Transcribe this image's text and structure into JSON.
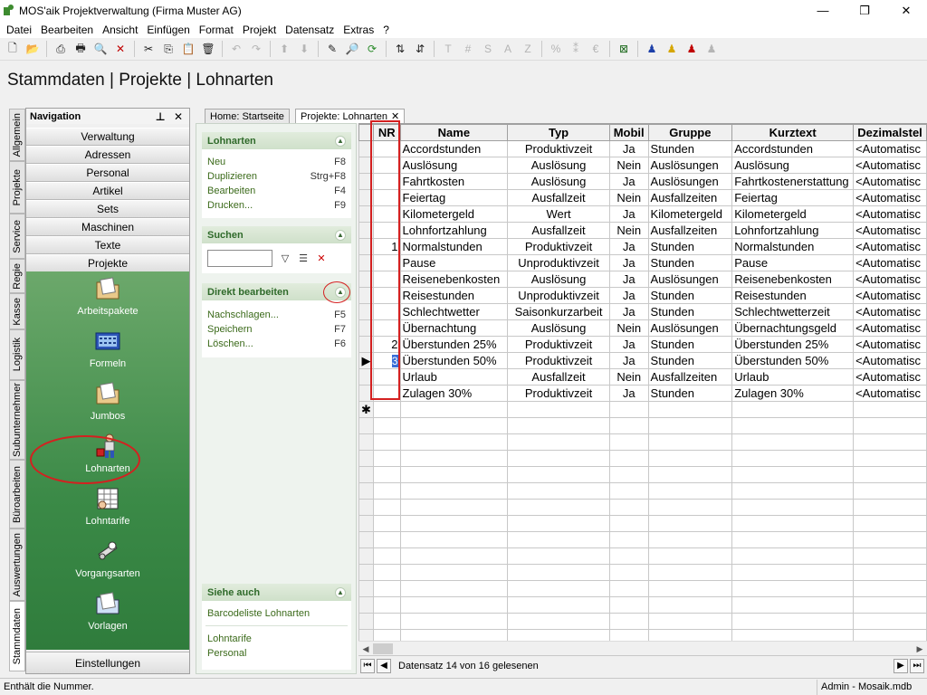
{
  "window": {
    "title": "MOS'aik Projektverwaltung (Firma Muster AG)",
    "minimize": "—",
    "maximize": "❐",
    "close": "✕"
  },
  "menu": [
    "Datei",
    "Bearbeiten",
    "Ansicht",
    "Einfügen",
    "Format",
    "Projekt",
    "Datensatz",
    "Extras",
    "?"
  ],
  "toolbar": {
    "items": [
      {
        "glyph": "🗋",
        "icon": "new-icon",
        "dis": false
      },
      {
        "glyph": "📂",
        "icon": "open-icon",
        "dis": false
      },
      {
        "sep": true
      },
      {
        "glyph": "⎙",
        "icon": "print-icon",
        "dis": false
      },
      {
        "glyph": "🖶",
        "icon": "print-preview-icon",
        "dis": false
      },
      {
        "glyph": "🔍",
        "icon": "find-icon",
        "dis": false
      },
      {
        "glyph": "✕",
        "icon": "delete-icon",
        "dis": false,
        "color": "#c00000"
      },
      {
        "sep": true
      },
      {
        "glyph": "✂",
        "icon": "cut-icon",
        "dis": false
      },
      {
        "glyph": "⎘",
        "icon": "copy-icon",
        "dis": false
      },
      {
        "glyph": "📋",
        "icon": "paste-icon",
        "dis": true
      },
      {
        "glyph": "🗑",
        "icon": "delete-doc-icon",
        "dis": false
      },
      {
        "sep": true
      },
      {
        "glyph": "↶",
        "icon": "undo-icon",
        "dis": true
      },
      {
        "glyph": "↷",
        "icon": "redo-icon",
        "dis": true
      },
      {
        "sep": true
      },
      {
        "glyph": "⬆",
        "icon": "move-up-icon",
        "dis": true
      },
      {
        "glyph": "⬇",
        "icon": "move-down-icon",
        "dis": true
      },
      {
        "sep": true
      },
      {
        "glyph": "✎",
        "icon": "edit-icon",
        "dis": false
      },
      {
        "glyph": "🔎",
        "icon": "zoom-icon",
        "dis": false
      },
      {
        "glyph": "⟳",
        "icon": "refresh-icon",
        "dis": false,
        "color": "#2a8a2a"
      },
      {
        "sep": true
      },
      {
        "glyph": "⇅",
        "icon": "sort-asc-icon",
        "dis": false
      },
      {
        "glyph": "⇵",
        "icon": "sort-desc-icon",
        "dis": false
      },
      {
        "sep": true
      },
      {
        "glyph": "T",
        "icon": "text-icon",
        "dis": true
      },
      {
        "glyph": "#",
        "icon": "number-icon",
        "dis": true
      },
      {
        "glyph": "S",
        "icon": "s-icon",
        "dis": true
      },
      {
        "glyph": "A",
        "icon": "a-icon",
        "dis": true
      },
      {
        "glyph": "Z",
        "icon": "z-icon",
        "dis": true
      },
      {
        "sep": true
      },
      {
        "glyph": "%",
        "icon": "percent-icon",
        "dis": true
      },
      {
        "glyph": "⁑",
        "icon": "decimal-icon",
        "dis": true
      },
      {
        "glyph": "€",
        "icon": "euro-icon",
        "dis": true
      },
      {
        "sep": true
      },
      {
        "glyph": "⊠",
        "icon": "excel-icon",
        "dis": false,
        "color": "#1f6b1f"
      },
      {
        "sep": true
      },
      {
        "glyph": "♟",
        "icon": "user-blue-icon",
        "dis": false,
        "color": "#1c3fa8"
      },
      {
        "glyph": "♟",
        "icon": "user-yellow-icon",
        "dis": false,
        "color": "#d6a600"
      },
      {
        "glyph": "♟",
        "icon": "user-red-icon",
        "dis": false,
        "color": "#c00000"
      },
      {
        "glyph": "♟",
        "icon": "user-gray-icon",
        "dis": true
      }
    ]
  },
  "page_title": "Stammdaten | Projekte | Lohnarten",
  "vertical_tabs": [
    "Allgemein",
    "Projekte",
    "Service",
    "Regie",
    "Kasse",
    "Logistik",
    "Subunternehmer",
    "Büroarbeiten",
    "Auswertungen",
    "Stammdaten"
  ],
  "navigation": {
    "title": "Navigation",
    "controls": "⊥ ✕",
    "categories": [
      "Verwaltung",
      "Adressen",
      "Personal",
      "Artikel",
      "Sets",
      "Maschinen",
      "Texte",
      "Projekte"
    ],
    "items": [
      {
        "label": "Arbeitspakete",
        "icon": "folder-icon"
      },
      {
        "label": "Formeln",
        "icon": "calculator-icon"
      },
      {
        "label": "Jumbos",
        "icon": "folder-icon"
      },
      {
        "label": "Lohnarten",
        "icon": "worker-icon"
      },
      {
        "label": "Lohntarife",
        "icon": "table-icon"
      },
      {
        "label": "Vorgangsarten",
        "icon": "tools-icon"
      },
      {
        "label": "Vorlagen",
        "icon": "folder-icon"
      }
    ],
    "bottom": "Einstellungen"
  },
  "doc_tabs": {
    "home": "Home: Startseite",
    "current": "Projekte: Lohnarten",
    "close": "✕"
  },
  "task_pane": {
    "lohnarten": {
      "title": "Lohnarten",
      "rows": [
        {
          "label": "Neu",
          "shortcut": "F8"
        },
        {
          "label": "Duplizieren",
          "shortcut": "Strg+F8"
        },
        {
          "label": "Bearbeiten",
          "shortcut": "F4"
        },
        {
          "label": "Drucken...",
          "shortcut": "F9"
        }
      ]
    },
    "suchen": {
      "title": "Suchen"
    },
    "direkt": {
      "title": "Direkt bearbeiten",
      "rows": [
        {
          "label": "Nachschlagen...",
          "shortcut": "F5"
        },
        {
          "label": "Speichern",
          "shortcut": "F7"
        },
        {
          "label": "Löschen...",
          "shortcut": "F6"
        }
      ]
    },
    "siehe_auch": {
      "title": "Siehe auch",
      "links": [
        "Barcodeliste Lohnarten",
        "Lohntarife",
        "Personal"
      ]
    }
  },
  "grid": {
    "columns": [
      "NR",
      "Name",
      "Typ",
      "Mobil",
      "Gruppe",
      "Kurztext",
      "Dezimalstel"
    ],
    "rows": [
      {
        "nr": "",
        "name": "Accordstunden",
        "typ": "Produktivzeit",
        "mobil": "Ja",
        "gruppe": "Stunden",
        "kurztext": "Accordstunden",
        "dez": "<Automatisc"
      },
      {
        "nr": "",
        "name": "Auslösung",
        "typ": "Auslösung",
        "mobil": "Nein",
        "gruppe": "Auslösungen",
        "kurztext": "Auslösung",
        "dez": "<Automatisc"
      },
      {
        "nr": "",
        "name": "Fahrtkosten",
        "typ": "Auslösung",
        "mobil": "Ja",
        "gruppe": "Auslösungen",
        "kurztext": "Fahrtkostenerstattung",
        "dez": "<Automatisc"
      },
      {
        "nr": "",
        "name": "Feiertag",
        "typ": "Ausfallzeit",
        "mobil": "Nein",
        "gruppe": "Ausfallzeiten",
        "kurztext": "Feiertag",
        "dez": "<Automatisc"
      },
      {
        "nr": "",
        "name": "Kilometergeld",
        "typ": "Wert",
        "mobil": "Ja",
        "gruppe": "Kilometergeld",
        "kurztext": "Kilometergeld",
        "dez": "<Automatisc"
      },
      {
        "nr": "",
        "name": "Lohnfortzahlung",
        "typ": "Ausfallzeit",
        "mobil": "Nein",
        "gruppe": "Ausfallzeiten",
        "kurztext": "Lohnfortzahlung",
        "dez": "<Automatisc"
      },
      {
        "nr": "1",
        "name": "Normalstunden",
        "typ": "Produktivzeit",
        "mobil": "Ja",
        "gruppe": "Stunden",
        "kurztext": "Normalstunden",
        "dez": "<Automatisc"
      },
      {
        "nr": "",
        "name": "Pause",
        "typ": "Unproduktivzeit",
        "mobil": "Ja",
        "gruppe": "Stunden",
        "kurztext": "Pause",
        "dez": "<Automatisc"
      },
      {
        "nr": "",
        "name": "Reisenebenkosten",
        "typ": "Auslösung",
        "mobil": "Ja",
        "gruppe": "Auslösungen",
        "kurztext": "Reisenebenkosten",
        "dez": "<Automatisc"
      },
      {
        "nr": "",
        "name": "Reisestunden",
        "typ": "Unproduktivzeit",
        "mobil": "Ja",
        "gruppe": "Stunden",
        "kurztext": "Reisestunden",
        "dez": "<Automatisc"
      },
      {
        "nr": "",
        "name": "Schlechtwetter",
        "typ": "Saisonkurzarbeit",
        "mobil": "Ja",
        "gruppe": "Stunden",
        "kurztext": "Schlechtwetterzeit",
        "dez": "<Automatisc"
      },
      {
        "nr": "",
        "name": "Übernachtung",
        "typ": "Auslösung",
        "mobil": "Nein",
        "gruppe": "Auslösungen",
        "kurztext": "Übernachtungsgeld",
        "dez": "<Automatisc"
      },
      {
        "nr": "2",
        "name": "Überstunden 25%",
        "typ": "Produktivzeit",
        "mobil": "Ja",
        "gruppe": "Stunden",
        "kurztext": "Überstunden 25%",
        "dez": "<Automatisc"
      },
      {
        "nr": "3",
        "name": "Überstunden 50%",
        "typ": "Produktivzeit",
        "mobil": "Ja",
        "gruppe": "Stunden",
        "kurztext": "Überstunden 50%",
        "dez": "<Automatisc",
        "current": true
      },
      {
        "nr": "",
        "name": "Urlaub",
        "typ": "Ausfallzeit",
        "mobil": "Nein",
        "gruppe": "Ausfallzeiten",
        "kurztext": "Urlaub",
        "dez": "<Automatisc"
      },
      {
        "nr": "",
        "name": "Zulagen 30%",
        "typ": "Produktivzeit",
        "mobil": "Ja",
        "gruppe": "Stunden",
        "kurztext": "Zulagen 30%",
        "dez": "<Automatisc"
      }
    ],
    "new_row_marker": "✱",
    "current_row_marker": "▶"
  },
  "record_nav": {
    "text": "Datensatz 14 von 16 gelesenen"
  },
  "status": {
    "left": "Enthält die Nummer.",
    "right": "Admin - Mosaik.mdb"
  },
  "colors": {
    "nav_green": "#3b8a47",
    "highlight_red": "#d42020",
    "taskpane_header": "#2f6a2a"
  }
}
